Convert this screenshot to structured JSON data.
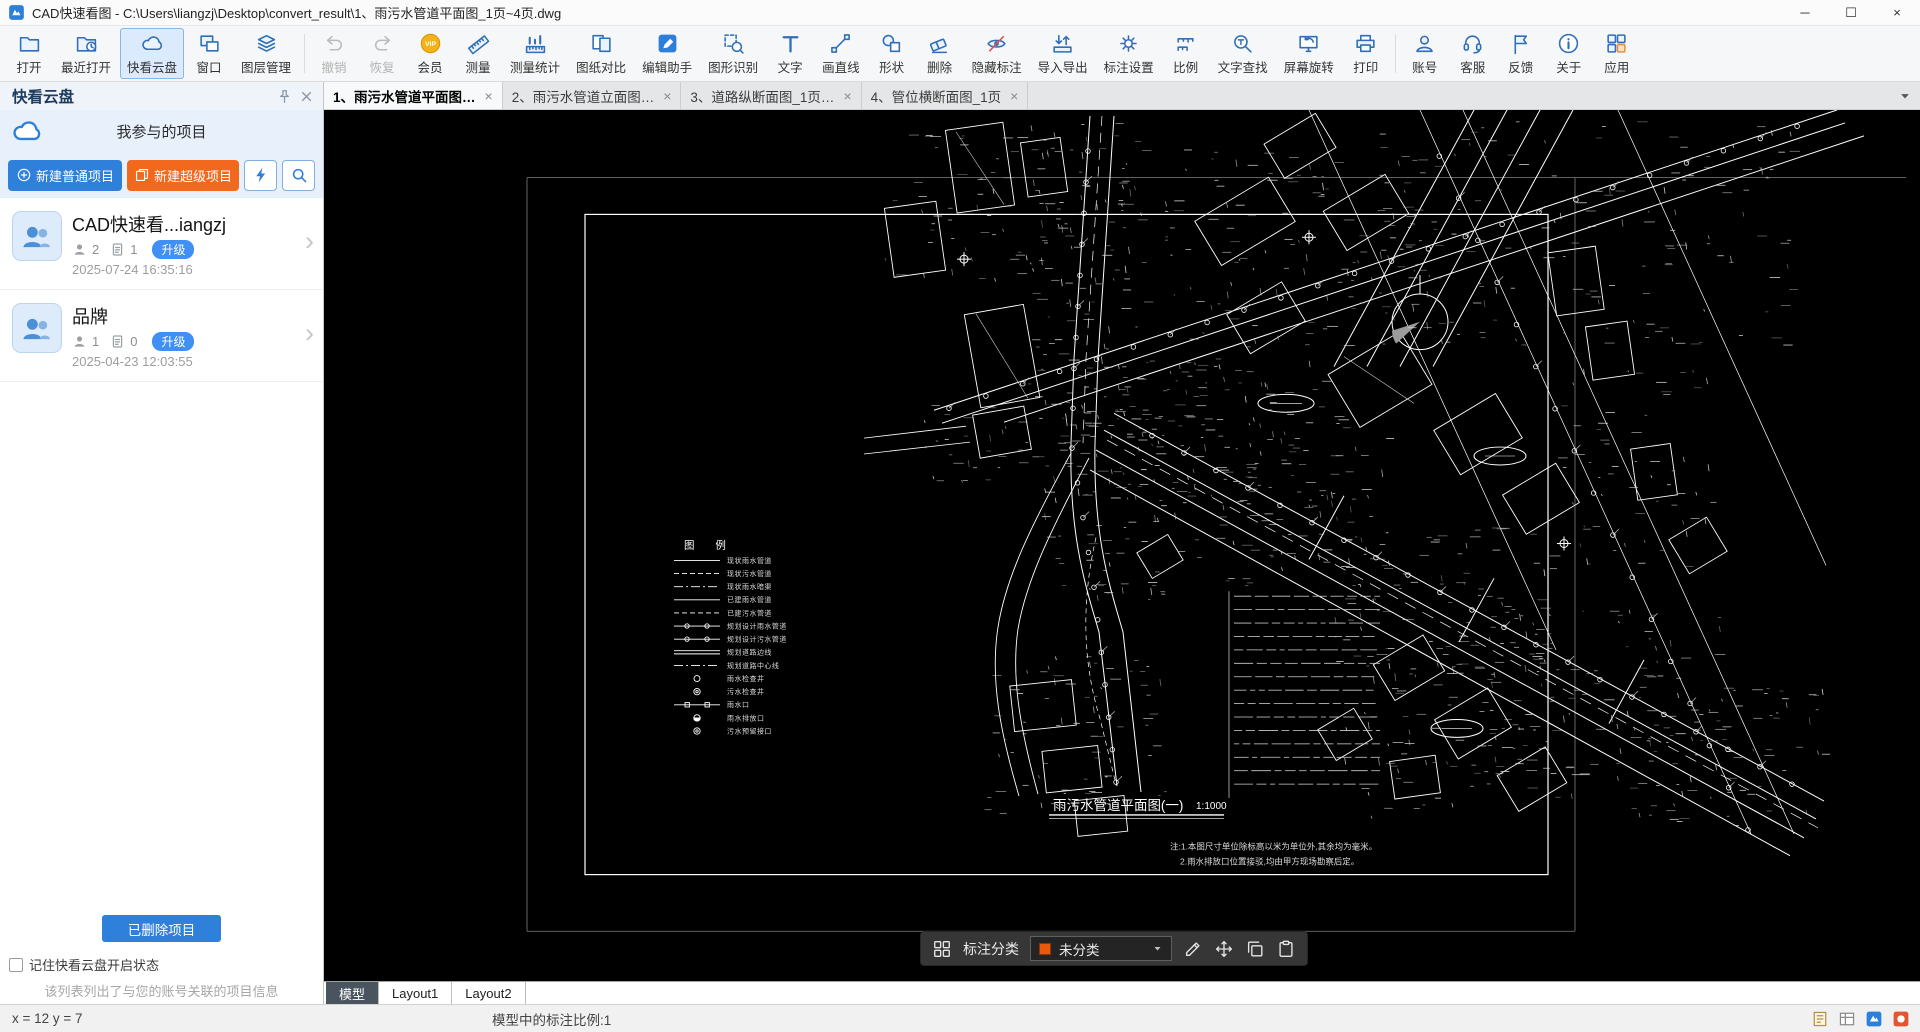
{
  "window": {
    "title": "CAD快速看图 - C:\\Users\\liangzj\\Desktop\\convert_result\\1、雨污水管道平面图_1页~4页.dwg",
    "minimize": "─",
    "maximize": "☐",
    "close": "×"
  },
  "toolbar": {
    "items": [
      {
        "label": "打开",
        "icon": "folder-open-icon"
      },
      {
        "label": "最近打开",
        "icon": "recent-icon"
      },
      {
        "label": "快看云盘",
        "icon": "cloud-icon",
        "active": true
      },
      {
        "label": "窗口",
        "icon": "window-icon"
      },
      {
        "label": "图层管理",
        "icon": "layers-icon"
      },
      {
        "sep": true
      },
      {
        "label": "撤销",
        "icon": "undo-icon",
        "disabled": true
      },
      {
        "label": "恢复",
        "icon": "redo-icon",
        "disabled": true
      },
      {
        "label": "会员",
        "icon": "vip-icon"
      },
      {
        "label": "测量",
        "icon": "ruler-icon"
      },
      {
        "label": "测量统计",
        "icon": "ruler-stats-icon"
      },
      {
        "label": "图纸对比",
        "icon": "compare-icon"
      },
      {
        "label": "编辑助手",
        "icon": "edit-assistant-icon"
      },
      {
        "label": "图形识别",
        "icon": "shape-recognize-icon"
      },
      {
        "label": "文字",
        "icon": "text-icon"
      },
      {
        "label": "画直线",
        "icon": "line-icon"
      },
      {
        "label": "形状",
        "icon": "shapes-icon"
      },
      {
        "label": "删除",
        "icon": "eraser-icon"
      },
      {
        "label": "隐藏标注",
        "icon": "hide-annotation-icon"
      },
      {
        "label": "导入导出",
        "icon": "import-export-icon"
      },
      {
        "label": "标注设置",
        "icon": "annotation-settings-icon"
      },
      {
        "label": "比例",
        "icon": "scale-icon"
      },
      {
        "label": "文字查找",
        "icon": "text-search-icon"
      },
      {
        "label": "屏幕旋转",
        "icon": "screen-rotate-icon"
      },
      {
        "label": "打印",
        "icon": "print-icon"
      },
      {
        "sep": true
      },
      {
        "label": "账号",
        "icon": "account-icon"
      },
      {
        "label": "客服",
        "icon": "support-icon"
      },
      {
        "label": "反馈",
        "icon": "flag-icon"
      },
      {
        "label": "关于",
        "icon": "about-icon"
      },
      {
        "label": "应用",
        "icon": "apps-icon"
      }
    ]
  },
  "doc_tabs": [
    {
      "label": "1、雨污水管道平面图…",
      "active": true
    },
    {
      "label": "2、雨污水管道立面图…"
    },
    {
      "label": "3、道路纵断面图_1页…"
    },
    {
      "label": "4、管位横断面图_1页"
    }
  ],
  "sidebar": {
    "title": "快看云盘",
    "section_title": "我参与的项目",
    "new_project_btn": "新建普通项目",
    "new_super_btn": "新建超级项目",
    "projects": [
      {
        "name": "CAD快速看...iangzj",
        "members": "2",
        "drawings": "1",
        "badge": "升级",
        "date": "2025-07-24 16:35:16"
      },
      {
        "name": "品牌",
        "members": "1",
        "drawings": "0",
        "badge": "升级",
        "date": "2025-04-23 12:03:55"
      }
    ],
    "deleted_btn": "已删除项目",
    "remember_label": "记住快看云盘开启状态",
    "hint": "该列表列出了与您的账号关联的项目信息"
  },
  "canvas_toolbar": {
    "label": "标注分类",
    "dropdown_value": "未分类"
  },
  "layout_tabs": [
    {
      "label": "模型",
      "active": true
    },
    {
      "label": "Layout1"
    },
    {
      "label": "Layout2"
    }
  ],
  "statusbar": {
    "coords": "x = 12 y = 7",
    "scale_text": "模型中的标注比例:1"
  },
  "drawing": {
    "legend_title": "图 例",
    "title": "雨污水管道平面图(一)",
    "scale": "1:1000",
    "notes": [
      "注:1.本图尺寸单位除标高以米为单位外,其余均为毫米。",
      "2.雨水排放口位置接驳,均由甲方现场勘察后定。"
    ],
    "legend_items": [
      {
        "symbol": "solid",
        "label": "现状雨水管道"
      },
      {
        "symbol": "dashed",
        "label": "现状污水管道"
      },
      {
        "symbol": "dashdot",
        "label": "现状雨水暗渠"
      },
      {
        "symbol": "solid",
        "label": "已建雨水管道"
      },
      {
        "symbol": "dashed",
        "label": "已建污水管道"
      },
      {
        "symbol": "circles",
        "label": "规划设计雨水管道"
      },
      {
        "symbol": "circles",
        "label": "规划设计污水管道"
      },
      {
        "symbol": "double",
        "label": "规划道路边线"
      },
      {
        "symbol": "dashdot",
        "label": "规划道路中心线"
      },
      {
        "symbol": "circle",
        "label": "雨水检查井"
      },
      {
        "symbol": "dcircle",
        "label": "污水检查井"
      },
      {
        "symbol": "squares",
        "label": "雨水口"
      },
      {
        "symbol": "halfdot",
        "label": "雨水排放口"
      },
      {
        "symbol": "dcircle",
        "label": "污水预留接口"
      }
    ]
  }
}
